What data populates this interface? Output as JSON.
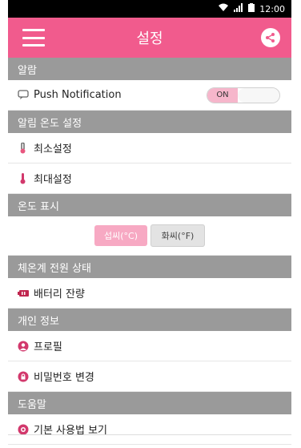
{
  "status": {
    "time": "12:00"
  },
  "appbar": {
    "title": "설정"
  },
  "sections": {
    "alarm": "알람",
    "alarm_temp": "알림 온도 설정",
    "temp_display": "온도 표시",
    "thermometer_power": "체온계 전원 상태",
    "personal_info": "개인 정보",
    "help": "도움말"
  },
  "items": {
    "push": "Push Notification",
    "min_setting": "최소설정",
    "max_setting": "최대설정",
    "battery": "배터리 잔량",
    "profile": "프로필",
    "change_password": "비밀번호 변경",
    "basic_usage": "기본 사용법 보기"
  },
  "toggle": {
    "push_state": "ON"
  },
  "units": {
    "celsius": "섭씨(°C)",
    "fahrenheit": "화씨(°F)"
  },
  "colors": {
    "accent": "#f15b8d",
    "section": "#9a9a9a",
    "unit_active": "#f7a9c3"
  }
}
